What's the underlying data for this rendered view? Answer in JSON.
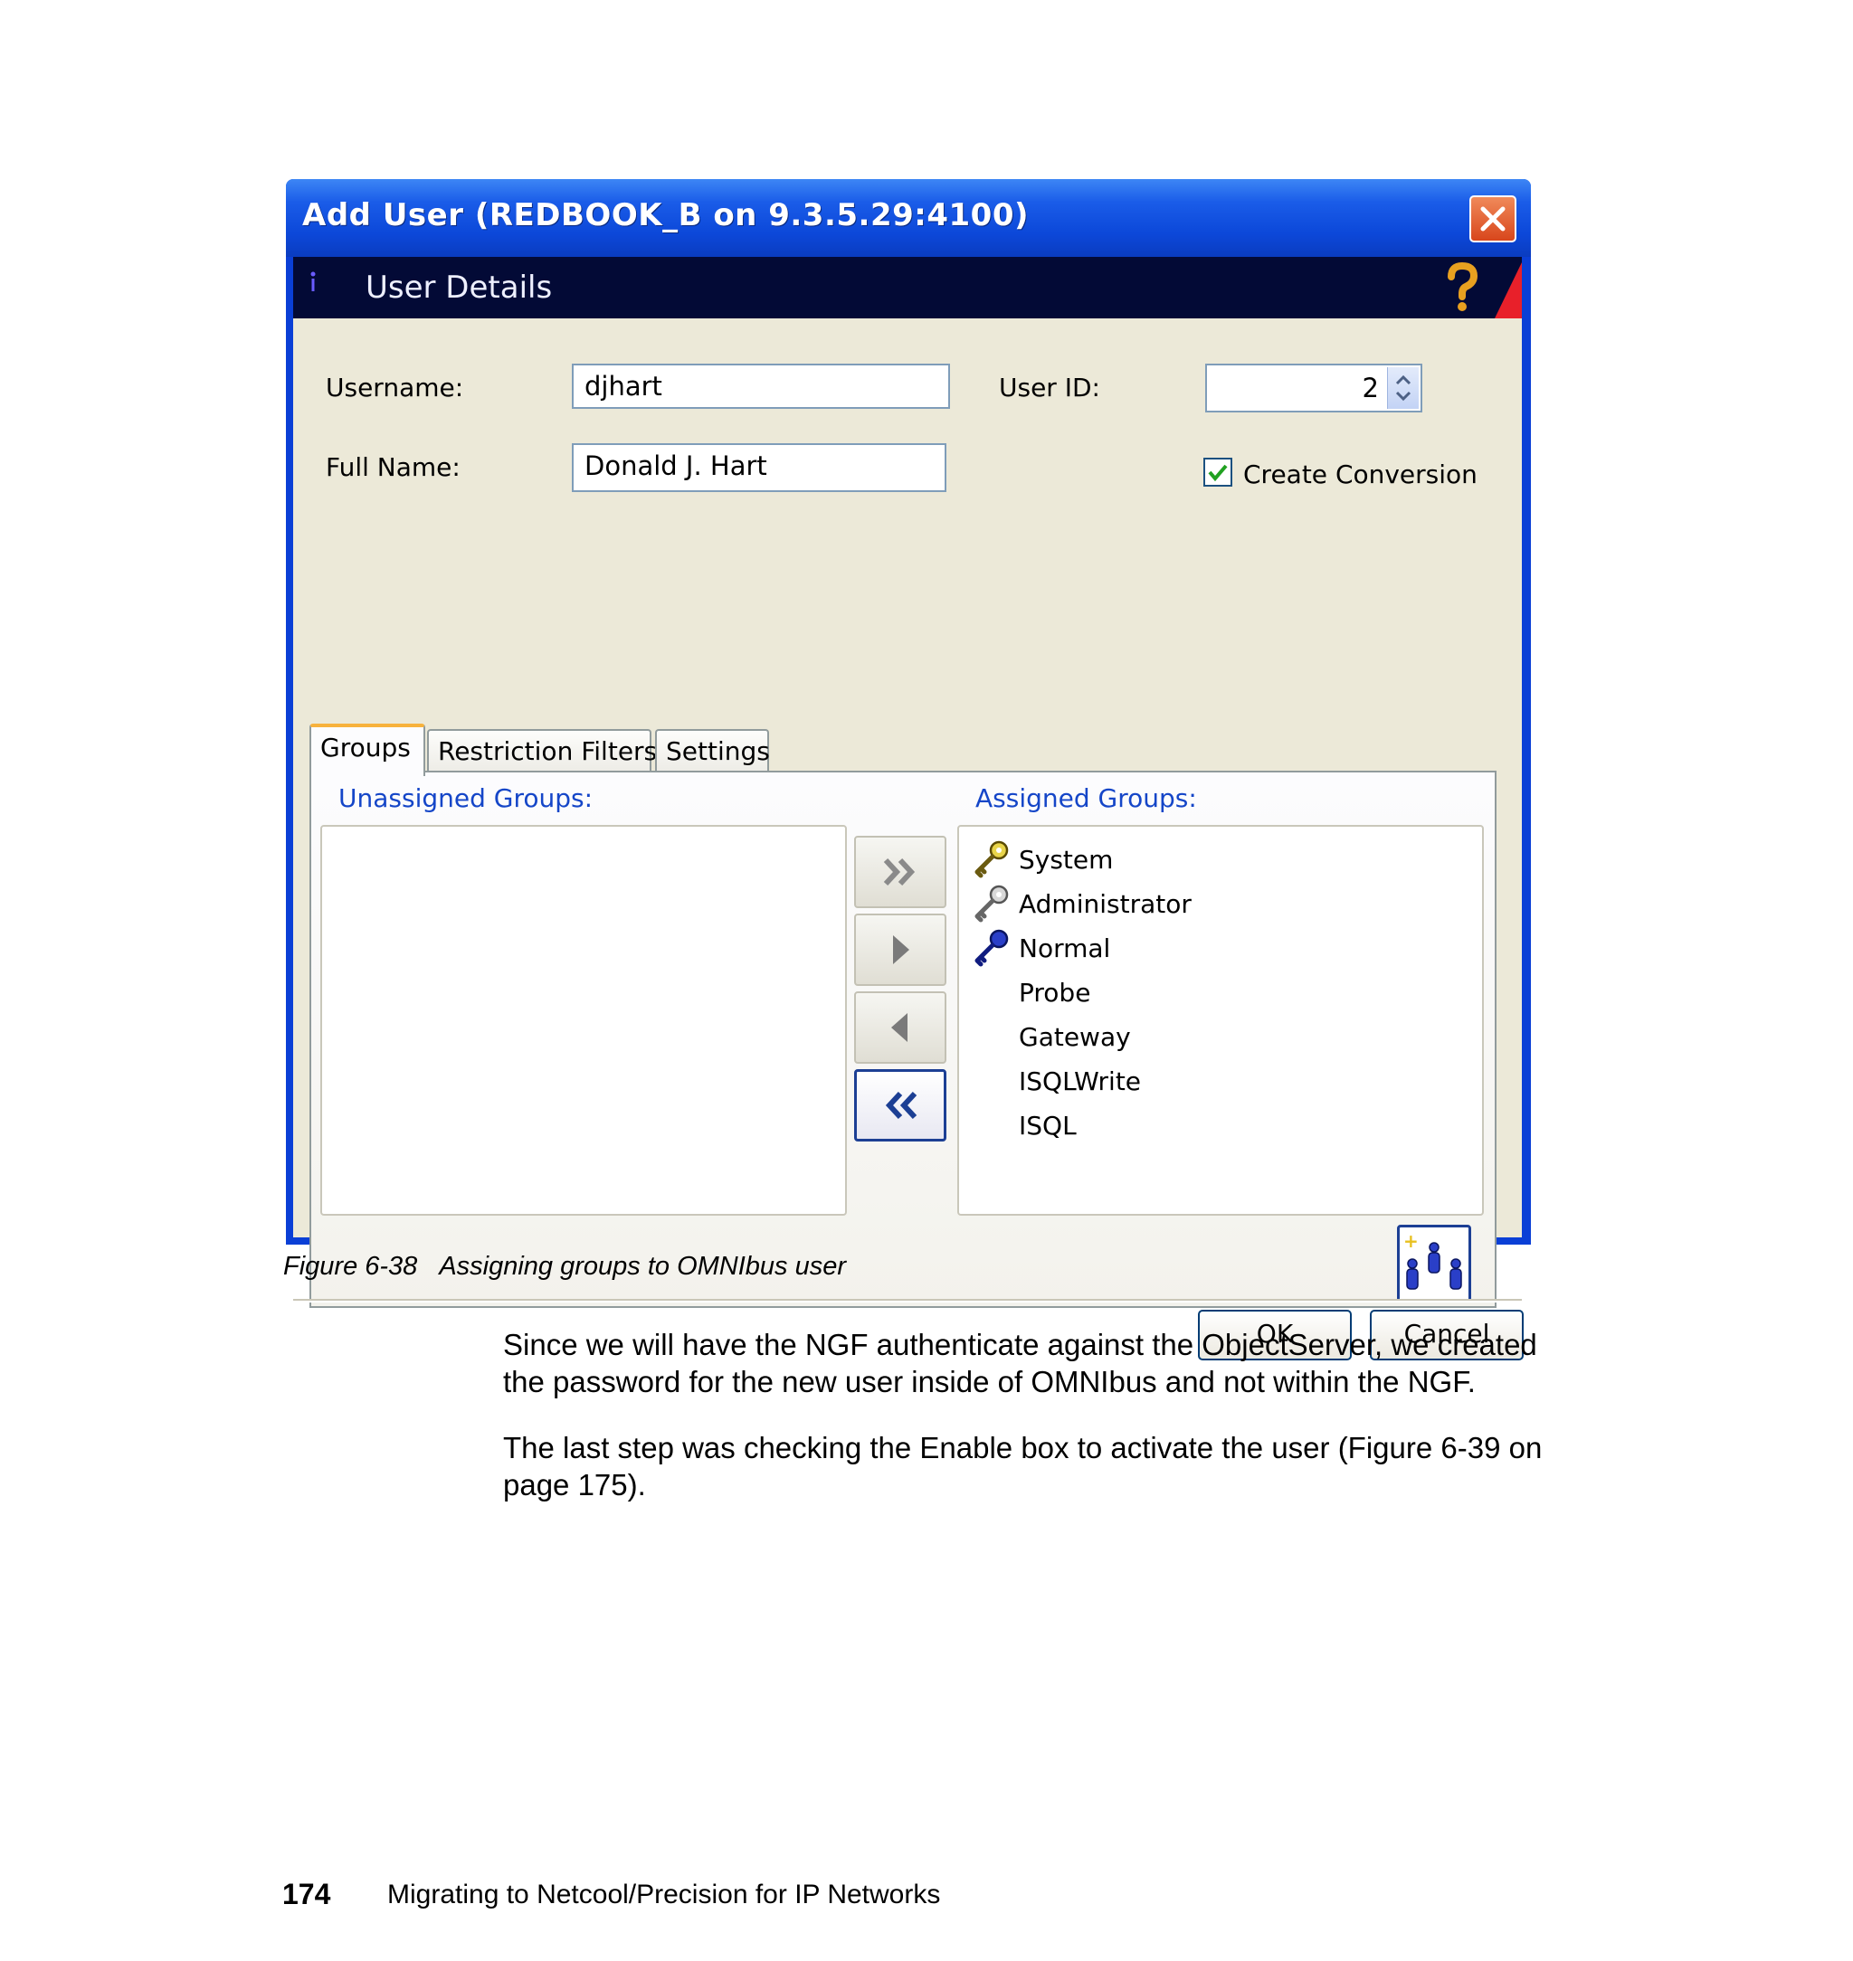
{
  "dialog": {
    "title": "Add User (REDBOOK_B on 9.3.5.29:4100)",
    "header_title": "User Details",
    "username_label": "Username:",
    "username_value": "djhart",
    "userid_label": "User ID:",
    "userid_value": "2",
    "fullname_label": "Full Name:",
    "fullname_value": "Donald J. Hart",
    "create_conversion_label": "Create Conversion",
    "create_conversion_checked": true,
    "tabs": [
      {
        "label": "Groups",
        "active": true
      },
      {
        "label": "Restriction Filters",
        "active": false
      },
      {
        "label": "Settings",
        "active": false
      }
    ],
    "unassigned_label": "Unassigned Groups:",
    "assigned_label": "Assigned Groups:",
    "unassigned_groups": [],
    "assigned_groups": [
      {
        "name": "System",
        "icon": "key-gold-icon"
      },
      {
        "name": "Administrator",
        "icon": "key-silver-icon"
      },
      {
        "name": "Normal",
        "icon": "key-blue-icon"
      },
      {
        "name": "Probe",
        "icon": ""
      },
      {
        "name": "Gateway",
        "icon": ""
      },
      {
        "name": "ISQLWrite",
        "icon": ""
      },
      {
        "name": "ISQL",
        "icon": ""
      }
    ],
    "ok_label": "OK",
    "cancel_label": "Cancel",
    "colors": {
      "titlebar": "#0a48d9",
      "header_band": "#030a36",
      "client_bg": "#ece9d8",
      "section_label": "#1546c8",
      "close_button": "#d8461c"
    }
  },
  "document": {
    "caption_number": "Figure 6-38",
    "caption_text": "Assigning groups to OMNIbus user",
    "paragraph1_line1": "Since we will have the NGF authenticate against the ObjectServer, we created",
    "paragraph1_line2": "the password for the new user inside of OMNIbus and not within the NGF.",
    "paragraph2_line1": "The last step was checking the Enable box to activate the user (Figure 6-39 on",
    "paragraph2_line2": "page 175).",
    "page_number": "174",
    "footer_title": "Migrating to Netcool/Precision for IP Networks"
  }
}
